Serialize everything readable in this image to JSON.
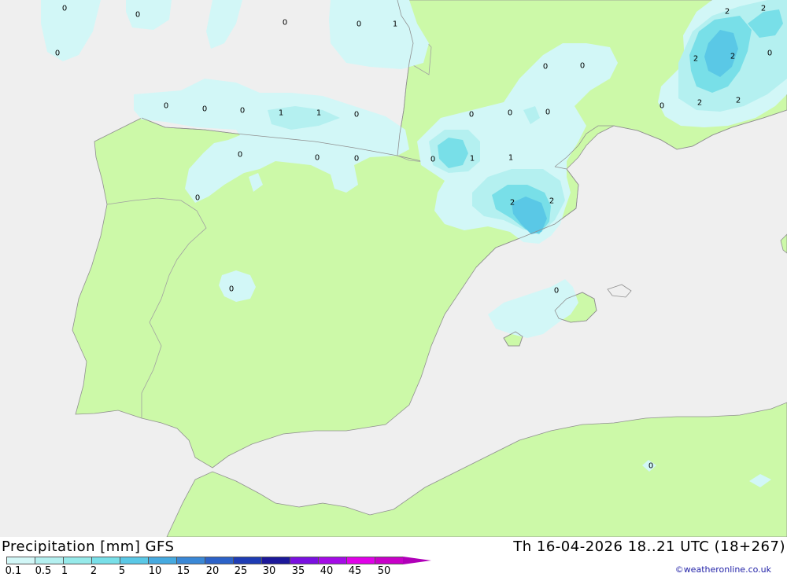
{
  "title": "Precipitation [mm] GFS",
  "datetime": "Th 16-04-2026 18..21 UTC (18+267)",
  "credit": "©weatheronline.co.uk",
  "colors": {
    "sea": "#efefef",
    "land": "#ccf9a8",
    "coast": "#909090",
    "border": "#a0a0a0"
  },
  "scale": {
    "ticks": [
      "0.1",
      "0.5",
      "1",
      "2",
      "5",
      "10",
      "15",
      "20",
      "25",
      "30",
      "35",
      "40",
      "45",
      "50"
    ],
    "colors": [
      "#d2f7f7",
      "#b4f0f0",
      "#96eaea",
      "#78dfe8",
      "#5ac8e6",
      "#46aae0",
      "#3a88d6",
      "#2c62c8",
      "#1e3cb4",
      "#1c189a",
      "#7a10e0",
      "#a40ce6",
      "#e002e8",
      "#c800c8"
    ],
    "arrow_color": "#b000b8"
  },
  "map_labels": [
    {
      "text": "0"
    },
    {
      "text": "0"
    },
    {
      "text": "0"
    },
    {
      "text": "0"
    },
    {
      "text": "0"
    },
    {
      "text": "1"
    },
    {
      "text": "0"
    },
    {
      "text": "0"
    },
    {
      "text": "0"
    },
    {
      "text": "1"
    },
    {
      "text": "1"
    },
    {
      "text": "0"
    },
    {
      "text": "0"
    },
    {
      "text": "0"
    },
    {
      "text": "0"
    },
    {
      "text": "0"
    },
    {
      "text": "0"
    },
    {
      "text": "0"
    },
    {
      "text": "0"
    },
    {
      "text": "0"
    },
    {
      "text": "0"
    },
    {
      "text": "1"
    },
    {
      "text": "0"
    },
    {
      "text": "1"
    },
    {
      "text": "2"
    },
    {
      "text": "2"
    },
    {
      "text": "0"
    },
    {
      "text": "0"
    },
    {
      "text": "2"
    },
    {
      "text": "2"
    },
    {
      "text": "2"
    },
    {
      "text": "2"
    },
    {
      "text": "0"
    },
    {
      "text": "0"
    },
    {
      "text": "2"
    },
    {
      "text": "2"
    },
    {
      "text": "0"
    }
  ]
}
